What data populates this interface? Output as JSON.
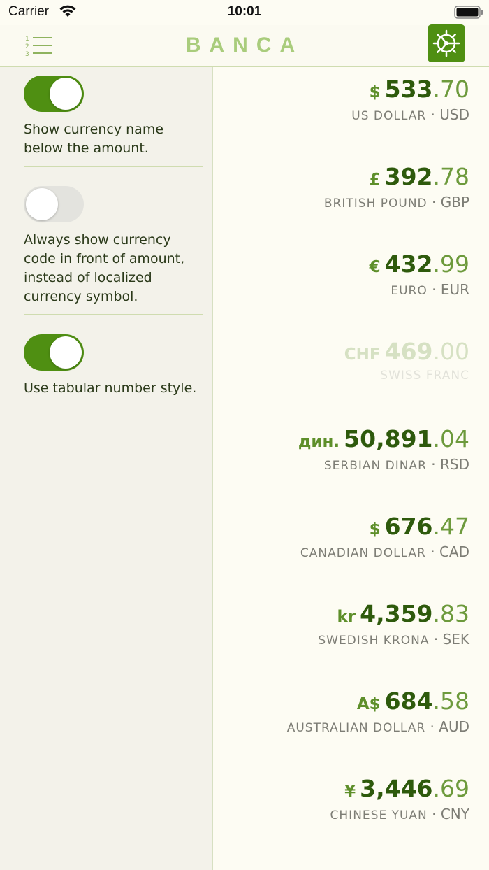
{
  "status_bar": {
    "carrier": "Carrier",
    "time": "10:01"
  },
  "navbar": {
    "title": "BANCA",
    "list_icon": "numbered-list-icon",
    "settings_icon": "gear-icon",
    "accent": "#4f8f12"
  },
  "settings": [
    {
      "text": "Show currency name below the amount.",
      "on": true
    },
    {
      "text": "Always show currency code in front of amount, instead of localized currency symbol.",
      "on": false
    },
    {
      "text": "Use tabular number style.",
      "on": true
    }
  ],
  "currencies": [
    {
      "symbol": "$",
      "int": "533",
      "dec": ".70",
      "name": "US DOLLAR",
      "code": "USD"
    },
    {
      "symbol": "£",
      "int": "392",
      "dec": ".78",
      "name": "BRITISH POUND",
      "code": "GBP"
    },
    {
      "symbol": "€",
      "int": "432",
      "dec": ".99",
      "name": "EURO",
      "code": "EUR"
    },
    {
      "symbol": "CHF",
      "int": "469",
      "dec": ".00",
      "name": "SWISS FRANC",
      "code": "",
      "faded": true
    },
    {
      "symbol": "дин.",
      "int": "50,891",
      "dec": ".04",
      "name": "SERBIAN DINAR",
      "code": "RSD"
    },
    {
      "symbol": "$",
      "int": "676",
      "dec": ".47",
      "name": "CANADIAN DOLLAR",
      "code": "CAD"
    },
    {
      "symbol": "kr",
      "int": "4,359",
      "dec": ".83",
      "name": "SWEDISH KRONA",
      "code": "SEK"
    },
    {
      "symbol": "A$",
      "int": "684",
      "dec": ".58",
      "name": "AUSTRALIAN DOLLAR",
      "code": "AUD"
    },
    {
      "symbol": "¥",
      "int": "3,446",
      "dec": ".69",
      "name": "CHINESE YUAN",
      "code": "CNY"
    }
  ]
}
